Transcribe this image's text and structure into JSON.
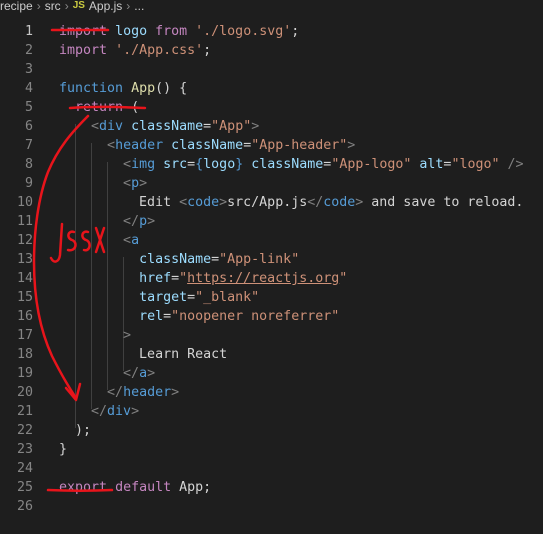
{
  "breadcrumb": {
    "segments": [
      "recipe",
      "src",
      "App.js",
      "..."
    ],
    "file_badge": "JS"
  },
  "code": {
    "lines": [
      {
        "n": "1",
        "parts": [
          [
            "kw",
            "import"
          ],
          [
            "pl",
            " "
          ],
          [
            "var",
            "logo"
          ],
          [
            "pl",
            " "
          ],
          [
            "kw",
            "from"
          ],
          [
            "pl",
            " "
          ],
          [
            "str",
            "'./logo.svg'"
          ],
          [
            "pl",
            ";"
          ]
        ]
      },
      {
        "n": "2",
        "parts": [
          [
            "kw",
            "import"
          ],
          [
            "pl",
            " "
          ],
          [
            "str",
            "'./App.css'"
          ],
          [
            "pl",
            ";"
          ]
        ]
      },
      {
        "n": "3",
        "parts": []
      },
      {
        "n": "4",
        "parts": [
          [
            "kwb",
            "function"
          ],
          [
            "pl",
            " "
          ],
          [
            "fn",
            "App"
          ],
          [
            "pl",
            "() {"
          ]
        ]
      },
      {
        "n": "5",
        "parts": [
          [
            "pl",
            "  "
          ],
          [
            "kw",
            "return"
          ],
          [
            "pl",
            " ("
          ]
        ]
      },
      {
        "n": "6",
        "parts": [
          [
            "pl",
            "    "
          ],
          [
            "ang",
            "<"
          ],
          [
            "tag",
            "div"
          ],
          [
            "pl",
            " "
          ],
          [
            "attr",
            "className"
          ],
          [
            "pl",
            "="
          ],
          [
            "str",
            "\"App\""
          ],
          [
            "ang",
            ">"
          ]
        ]
      },
      {
        "n": "7",
        "parts": [
          [
            "pl",
            "      "
          ],
          [
            "ang",
            "<"
          ],
          [
            "tag",
            "header"
          ],
          [
            "pl",
            " "
          ],
          [
            "attr",
            "className"
          ],
          [
            "pl",
            "="
          ],
          [
            "str",
            "\"App-header\""
          ],
          [
            "ang",
            ">"
          ]
        ]
      },
      {
        "n": "8",
        "parts": [
          [
            "pl",
            "        "
          ],
          [
            "ang",
            "<"
          ],
          [
            "tag",
            "img"
          ],
          [
            "pl",
            " "
          ],
          [
            "attr",
            "src"
          ],
          [
            "pl",
            "="
          ],
          [
            "kwb",
            "{"
          ],
          [
            "var",
            "logo"
          ],
          [
            "kwb",
            "}"
          ],
          [
            "pl",
            " "
          ],
          [
            "attr",
            "className"
          ],
          [
            "pl",
            "="
          ],
          [
            "str",
            "\"App-logo\""
          ],
          [
            "pl",
            " "
          ],
          [
            "attr",
            "alt"
          ],
          [
            "pl",
            "="
          ],
          [
            "str",
            "\"logo\""
          ],
          [
            "pl",
            " "
          ],
          [
            "ang",
            "/>"
          ]
        ]
      },
      {
        "n": "9",
        "parts": [
          [
            "pl",
            "        "
          ],
          [
            "ang",
            "<"
          ],
          [
            "tag",
            "p"
          ],
          [
            "ang",
            ">"
          ]
        ]
      },
      {
        "n": "10",
        "parts": [
          [
            "pl",
            "          Edit "
          ],
          [
            "ang",
            "<"
          ],
          [
            "tag",
            "code"
          ],
          [
            "ang",
            ">"
          ],
          [
            "pl",
            "src/App.js"
          ],
          [
            "ang",
            "</"
          ],
          [
            "tag",
            "code"
          ],
          [
            "ang",
            ">"
          ],
          [
            "pl",
            " and save to reload."
          ]
        ]
      },
      {
        "n": "11",
        "parts": [
          [
            "pl",
            "        "
          ],
          [
            "ang",
            "</"
          ],
          [
            "tag",
            "p"
          ],
          [
            "ang",
            ">"
          ]
        ]
      },
      {
        "n": "12",
        "parts": [
          [
            "pl",
            "        "
          ],
          [
            "ang",
            "<"
          ],
          [
            "tag",
            "a"
          ]
        ]
      },
      {
        "n": "13",
        "parts": [
          [
            "pl",
            "          "
          ],
          [
            "attr",
            "className"
          ],
          [
            "pl",
            "="
          ],
          [
            "str",
            "\"App-link\""
          ]
        ]
      },
      {
        "n": "14",
        "parts": [
          [
            "pl",
            "          "
          ],
          [
            "attr",
            "href"
          ],
          [
            "pl",
            "="
          ],
          [
            "str",
            "\""
          ],
          [
            "strul",
            "https://reactjs.org"
          ],
          [
            "str",
            "\""
          ]
        ]
      },
      {
        "n": "15",
        "parts": [
          [
            "pl",
            "          "
          ],
          [
            "attr",
            "target"
          ],
          [
            "pl",
            "="
          ],
          [
            "str",
            "\"_blank\""
          ]
        ]
      },
      {
        "n": "16",
        "parts": [
          [
            "pl",
            "          "
          ],
          [
            "attr",
            "rel"
          ],
          [
            "pl",
            "="
          ],
          [
            "str",
            "\"noopener noreferrer\""
          ]
        ]
      },
      {
        "n": "17",
        "parts": [
          [
            "pl",
            "        "
          ],
          [
            "ang",
            ">"
          ]
        ]
      },
      {
        "n": "18",
        "parts": [
          [
            "pl",
            "          Learn React"
          ]
        ]
      },
      {
        "n": "19",
        "parts": [
          [
            "pl",
            "        "
          ],
          [
            "ang",
            "</"
          ],
          [
            "tag",
            "a"
          ],
          [
            "ang",
            ">"
          ]
        ]
      },
      {
        "n": "20",
        "parts": [
          [
            "pl",
            "      "
          ],
          [
            "ang",
            "</"
          ],
          [
            "tag",
            "header"
          ],
          [
            "ang",
            ">"
          ]
        ]
      },
      {
        "n": "21",
        "parts": [
          [
            "pl",
            "    "
          ],
          [
            "ang",
            "</"
          ],
          [
            "tag",
            "div"
          ],
          [
            "ang",
            ">"
          ]
        ]
      },
      {
        "n": "22",
        "parts": [
          [
            "pl",
            "  );"
          ]
        ]
      },
      {
        "n": "23",
        "parts": [
          [
            "pl",
            "}"
          ]
        ]
      },
      {
        "n": "24",
        "parts": []
      },
      {
        "n": "25",
        "parts": [
          [
            "kw",
            "export"
          ],
          [
            "pl",
            " "
          ],
          [
            "kw",
            "default"
          ],
          [
            "pl",
            " "
          ],
          [
            "pl",
            "App;"
          ]
        ]
      },
      {
        "n": "26",
        "parts": []
      }
    ],
    "active_line": "1"
  },
  "annotation": {
    "handwritten_text": "JSX",
    "ink_color": "#e8141b"
  }
}
